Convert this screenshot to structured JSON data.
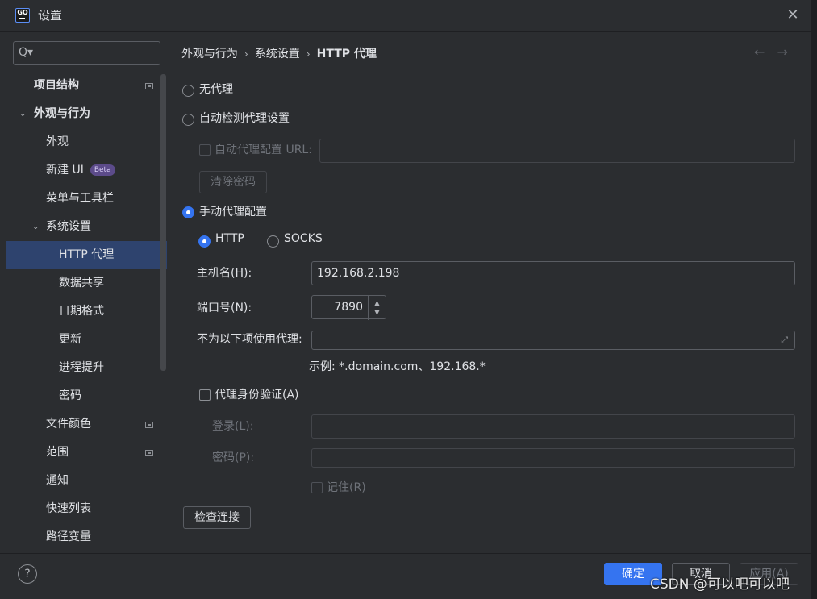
{
  "window": {
    "title": "设置",
    "app_icon": "GO",
    "close": "✕"
  },
  "sidebar": {
    "search_icon": "Q▾",
    "items": [
      {
        "label": "项目结构",
        "bold": true
      },
      {
        "label": "外观与行为",
        "bold": true,
        "expanded": true
      },
      {
        "label": "外观"
      },
      {
        "label": "新建 UI",
        "badge": "Beta"
      },
      {
        "label": "菜单与工具栏"
      },
      {
        "label": "系统设置",
        "expanded": true
      },
      {
        "label": "HTTP 代理",
        "selected": true
      },
      {
        "label": "数据共享"
      },
      {
        "label": "日期格式"
      },
      {
        "label": "更新"
      },
      {
        "label": "进程提升"
      },
      {
        "label": "密码"
      },
      {
        "label": "文件颜色"
      },
      {
        "label": "范围"
      },
      {
        "label": "通知"
      },
      {
        "label": "快速列表"
      },
      {
        "label": "路径变量"
      }
    ]
  },
  "breadcrumb": {
    "part1": "外观与行为",
    "part2": "系统设置",
    "part3": "HTTP 代理",
    "sep": "›",
    "back": "←",
    "forward": "→"
  },
  "proxy": {
    "no_proxy": "无代理",
    "auto_detect": "自动检测代理设置",
    "auto_config_label": "自动代理配置 URL:",
    "auto_config_url": "",
    "clear_passwords": "清除密码",
    "manual": "手动代理配置",
    "http": "HTTP",
    "socks": "SOCKS",
    "host_label": "主机名(H):",
    "host_value": "192.168.2.198",
    "port_label": "端口号(N):",
    "port_value": "7890",
    "no_proxy_for_label": "不为以下项使用代理:",
    "no_proxy_for_value": "",
    "example": "示例: *.domain.com、192.168.*",
    "auth_label": "代理身份验证(A)",
    "login_label": "登录(L):",
    "login_value": "",
    "password_label": "密码(P):",
    "password_value": "",
    "remember_label": "记住(R)",
    "check_connection": "检查连接"
  },
  "footer": {
    "help": "?",
    "ok": "确定",
    "cancel": "取消",
    "apply": "应用(A)"
  },
  "watermark": "CSDN @可以吧可以吧",
  "colors": {
    "accent": "#3574f0",
    "bg": "#2b2d30",
    "selected": "#2e436e"
  }
}
